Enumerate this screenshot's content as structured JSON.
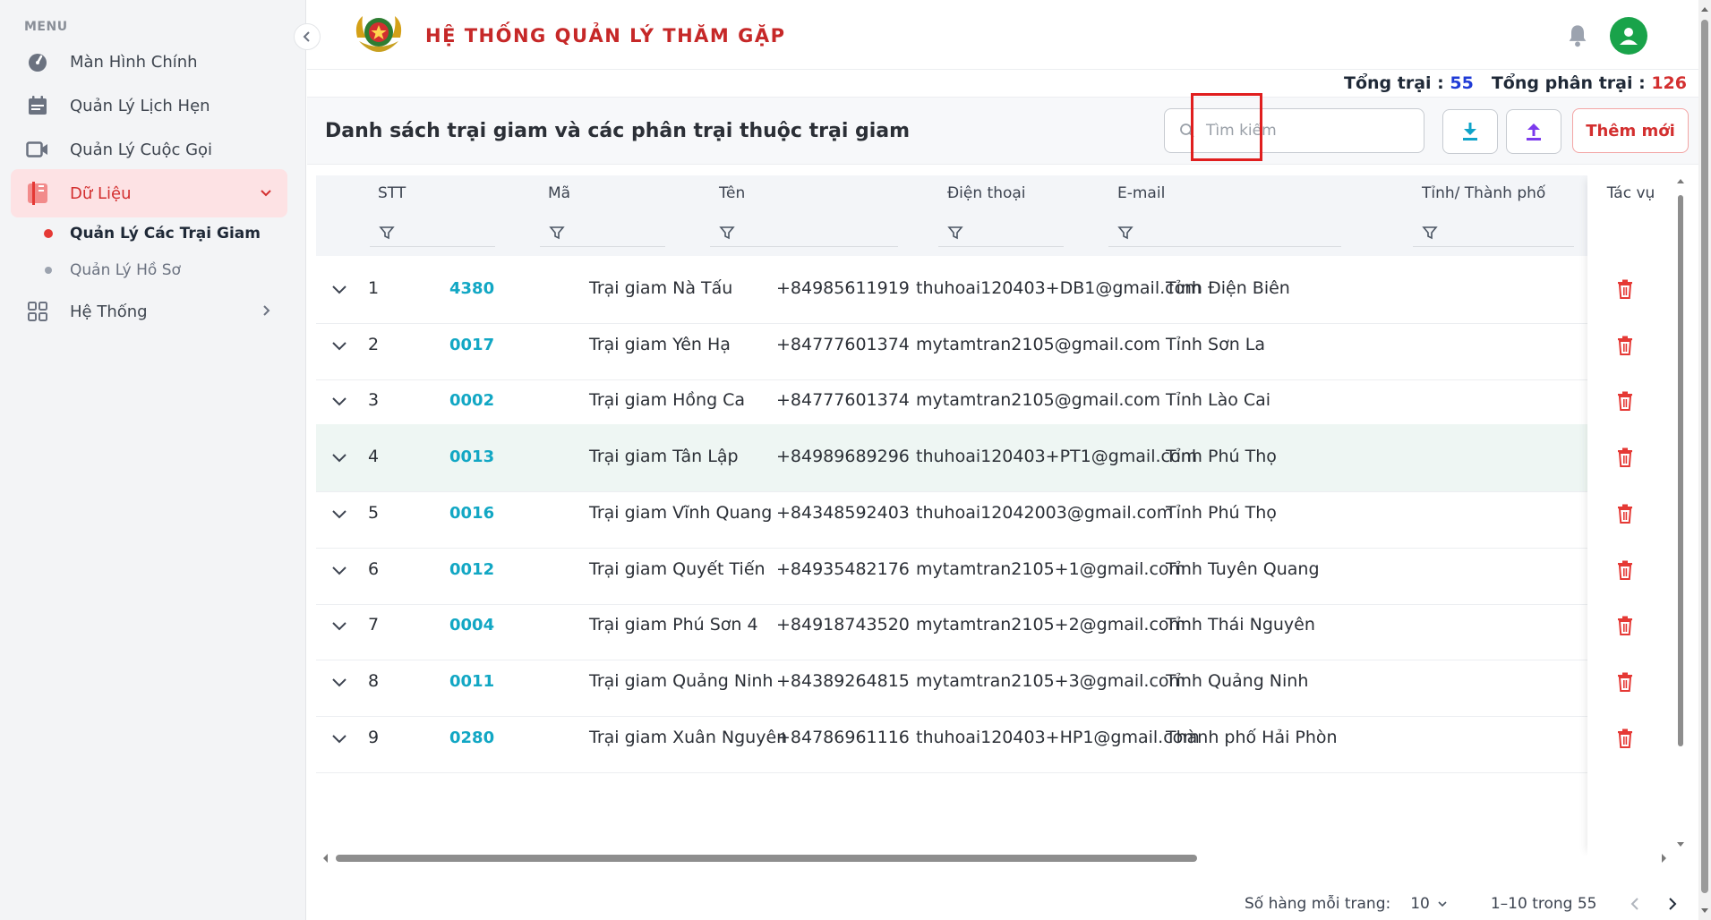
{
  "sidebar": {
    "menu_label": "MENU",
    "items": [
      {
        "label": "Màn Hình Chính",
        "icon": "dashboard-gauge-icon"
      },
      {
        "label": "Quản Lý Lịch Hẹn",
        "icon": "calendar-icon"
      },
      {
        "label": "Quản Lý Cuộc Gọi",
        "icon": "video-camera-icon"
      },
      {
        "label": "Dữ Liệu",
        "icon": "folder-data-icon",
        "active": true
      },
      {
        "label": "Hệ Thống",
        "icon": "grid-apps-icon"
      }
    ],
    "sub_items": [
      {
        "label": "Quản Lý Các Trại Giam",
        "current": true
      },
      {
        "label": "Quản Lý Hồ Sơ",
        "current": false
      }
    ]
  },
  "header": {
    "title": "HỆ THỐNG QUẢN LÝ THĂM GẶP"
  },
  "totals": {
    "camps_label": "Tổng trại :",
    "camps_value": "55",
    "subcamps_label": "Tổng phân trại :",
    "subcamps_value": "126"
  },
  "panel": {
    "title": "Danh sách trại giam và các phân trại thuộc trại giam",
    "search_placeholder": "Tìm kiếm",
    "add_label": "Thêm mới"
  },
  "table": {
    "columns": [
      "STT",
      "Mã",
      "Tên",
      "Điện thoại",
      "E-mail",
      "Tỉnh/ Thành phố"
    ],
    "action_header": "Tác vụ",
    "rows": [
      {
        "stt": "1",
        "code": "4380",
        "name": "Trại giam Nà Tấu",
        "phone": "+84985611919",
        "email": "thuhoai120403+DB1@gmail.com",
        "province": "Tỉnh Điện Biên"
      },
      {
        "stt": "2",
        "code": "0017",
        "name": "Trại giam Yên Hạ",
        "phone": "+84777601374",
        "email": "mytamtran2105@gmail.com",
        "province": "Tỉnh Sơn La"
      },
      {
        "stt": "3",
        "code": "0002",
        "name": "Trại giam Hồng Ca",
        "phone": "+84777601374",
        "email": "mytamtran2105@gmail.com",
        "province": "Tỉnh Lào Cai"
      },
      {
        "stt": "4",
        "code": "0013",
        "name": "Trại giam Tân Lập",
        "phone": "+84989689296",
        "email": "thuhoai120403+PT1@gmail.com",
        "province": "Tỉnh Phú Thọ"
      },
      {
        "stt": "5",
        "code": "0016",
        "name": "Trại giam Vĩnh Quang",
        "phone": "+84348592403",
        "email": "thuhoai12042003@gmail.com",
        "province": "Tỉnh Phú Thọ"
      },
      {
        "stt": "6",
        "code": "0012",
        "name": "Trại giam Quyết Tiến",
        "phone": "+84935482176",
        "email": "mytamtran2105+1@gmail.com",
        "province": "Tỉnh Tuyên Quang"
      },
      {
        "stt": "7",
        "code": "0004",
        "name": "Trại giam Phú Sơn 4",
        "phone": "+84918743520",
        "email": "mytamtran2105+2@gmail.com",
        "province": "Tỉnh Thái Nguyên"
      },
      {
        "stt": "8",
        "code": "0011",
        "name": "Trại giam Quảng Ninh",
        "phone": "+84389264815",
        "email": "mytamtran2105+3@gmail.com",
        "province": "Tỉnh Quảng Ninh"
      },
      {
        "stt": "9",
        "code": "0280",
        "name": "Trại giam Xuân Nguyên",
        "phone": "+84786961116",
        "email": "thuhoai120403+HP1@gmail.com",
        "province": "Thành phố Hải Phòn"
      }
    ]
  },
  "pagination": {
    "rows_per_page_label": "Số hàng mỗi trang:",
    "rows_per_page": "10",
    "range": "1–10 trong 55"
  },
  "colors": {
    "brand_red": "#d32f2f",
    "code_teal": "#12a7c4",
    "upload_purple": "#7c3aed",
    "download_teal": "#0fa3c9",
    "avatar_green": "#19a34a"
  }
}
